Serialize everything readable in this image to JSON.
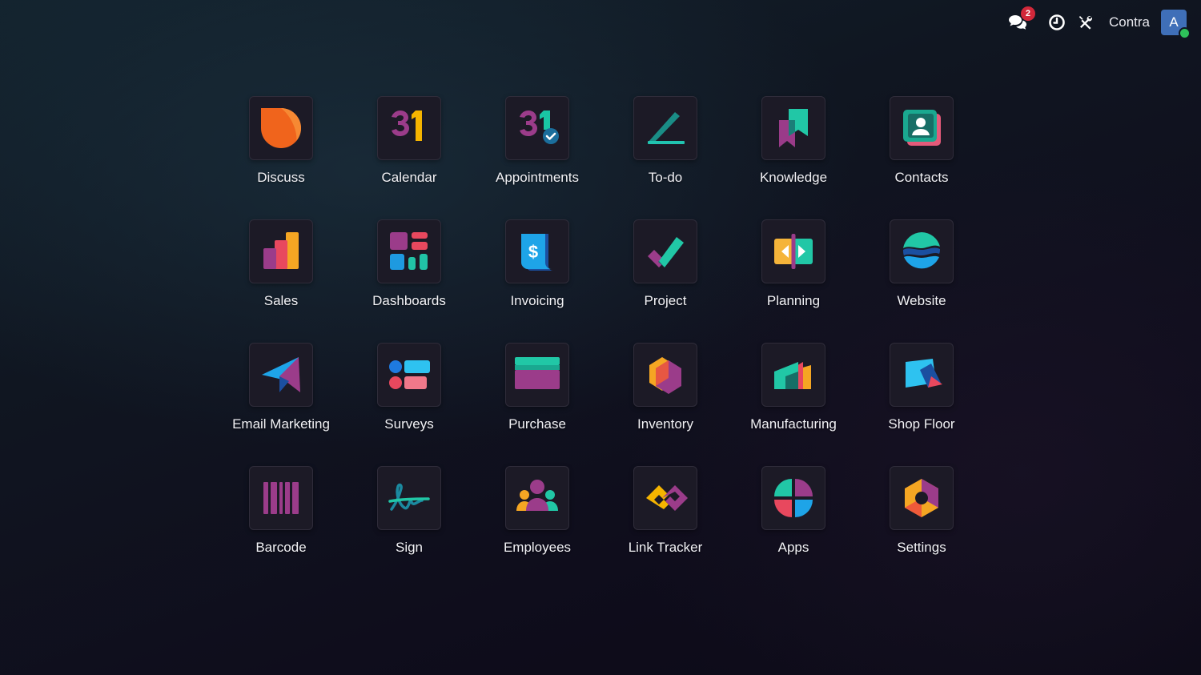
{
  "topbar": {
    "messages_badge": "2",
    "company_name": "Contra",
    "user_initial": "A"
  },
  "apps": [
    {
      "label": "Discuss",
      "icon": "discuss-icon"
    },
    {
      "label": "Calendar",
      "icon": "calendar-icon"
    },
    {
      "label": "Appointments",
      "icon": "appointments-icon"
    },
    {
      "label": "To-do",
      "icon": "todo-icon"
    },
    {
      "label": "Knowledge",
      "icon": "knowledge-icon"
    },
    {
      "label": "Contacts",
      "icon": "contacts-icon"
    },
    {
      "label": "Sales",
      "icon": "sales-icon"
    },
    {
      "label": "Dashboards",
      "icon": "dashboards-icon"
    },
    {
      "label": "Invoicing",
      "icon": "invoicing-icon"
    },
    {
      "label": "Project",
      "icon": "project-icon"
    },
    {
      "label": "Planning",
      "icon": "planning-icon"
    },
    {
      "label": "Website",
      "icon": "website-icon"
    },
    {
      "label": "Email Marketing",
      "icon": "email-marketing-icon"
    },
    {
      "label": "Surveys",
      "icon": "surveys-icon"
    },
    {
      "label": "Purchase",
      "icon": "purchase-icon"
    },
    {
      "label": "Inventory",
      "icon": "inventory-icon"
    },
    {
      "label": "Manufacturing",
      "icon": "manufacturing-icon"
    },
    {
      "label": "Shop Floor",
      "icon": "shop-floor-icon"
    },
    {
      "label": "Barcode",
      "icon": "barcode-icon"
    },
    {
      "label": "Sign",
      "icon": "sign-icon"
    },
    {
      "label": "Employees",
      "icon": "employees-icon"
    },
    {
      "label": "Link Tracker",
      "icon": "link-tracker-icon"
    },
    {
      "label": "Apps",
      "icon": "apps-icon"
    },
    {
      "label": "Settings",
      "icon": "settings-icon"
    }
  ],
  "calendar_icon_text": "31"
}
